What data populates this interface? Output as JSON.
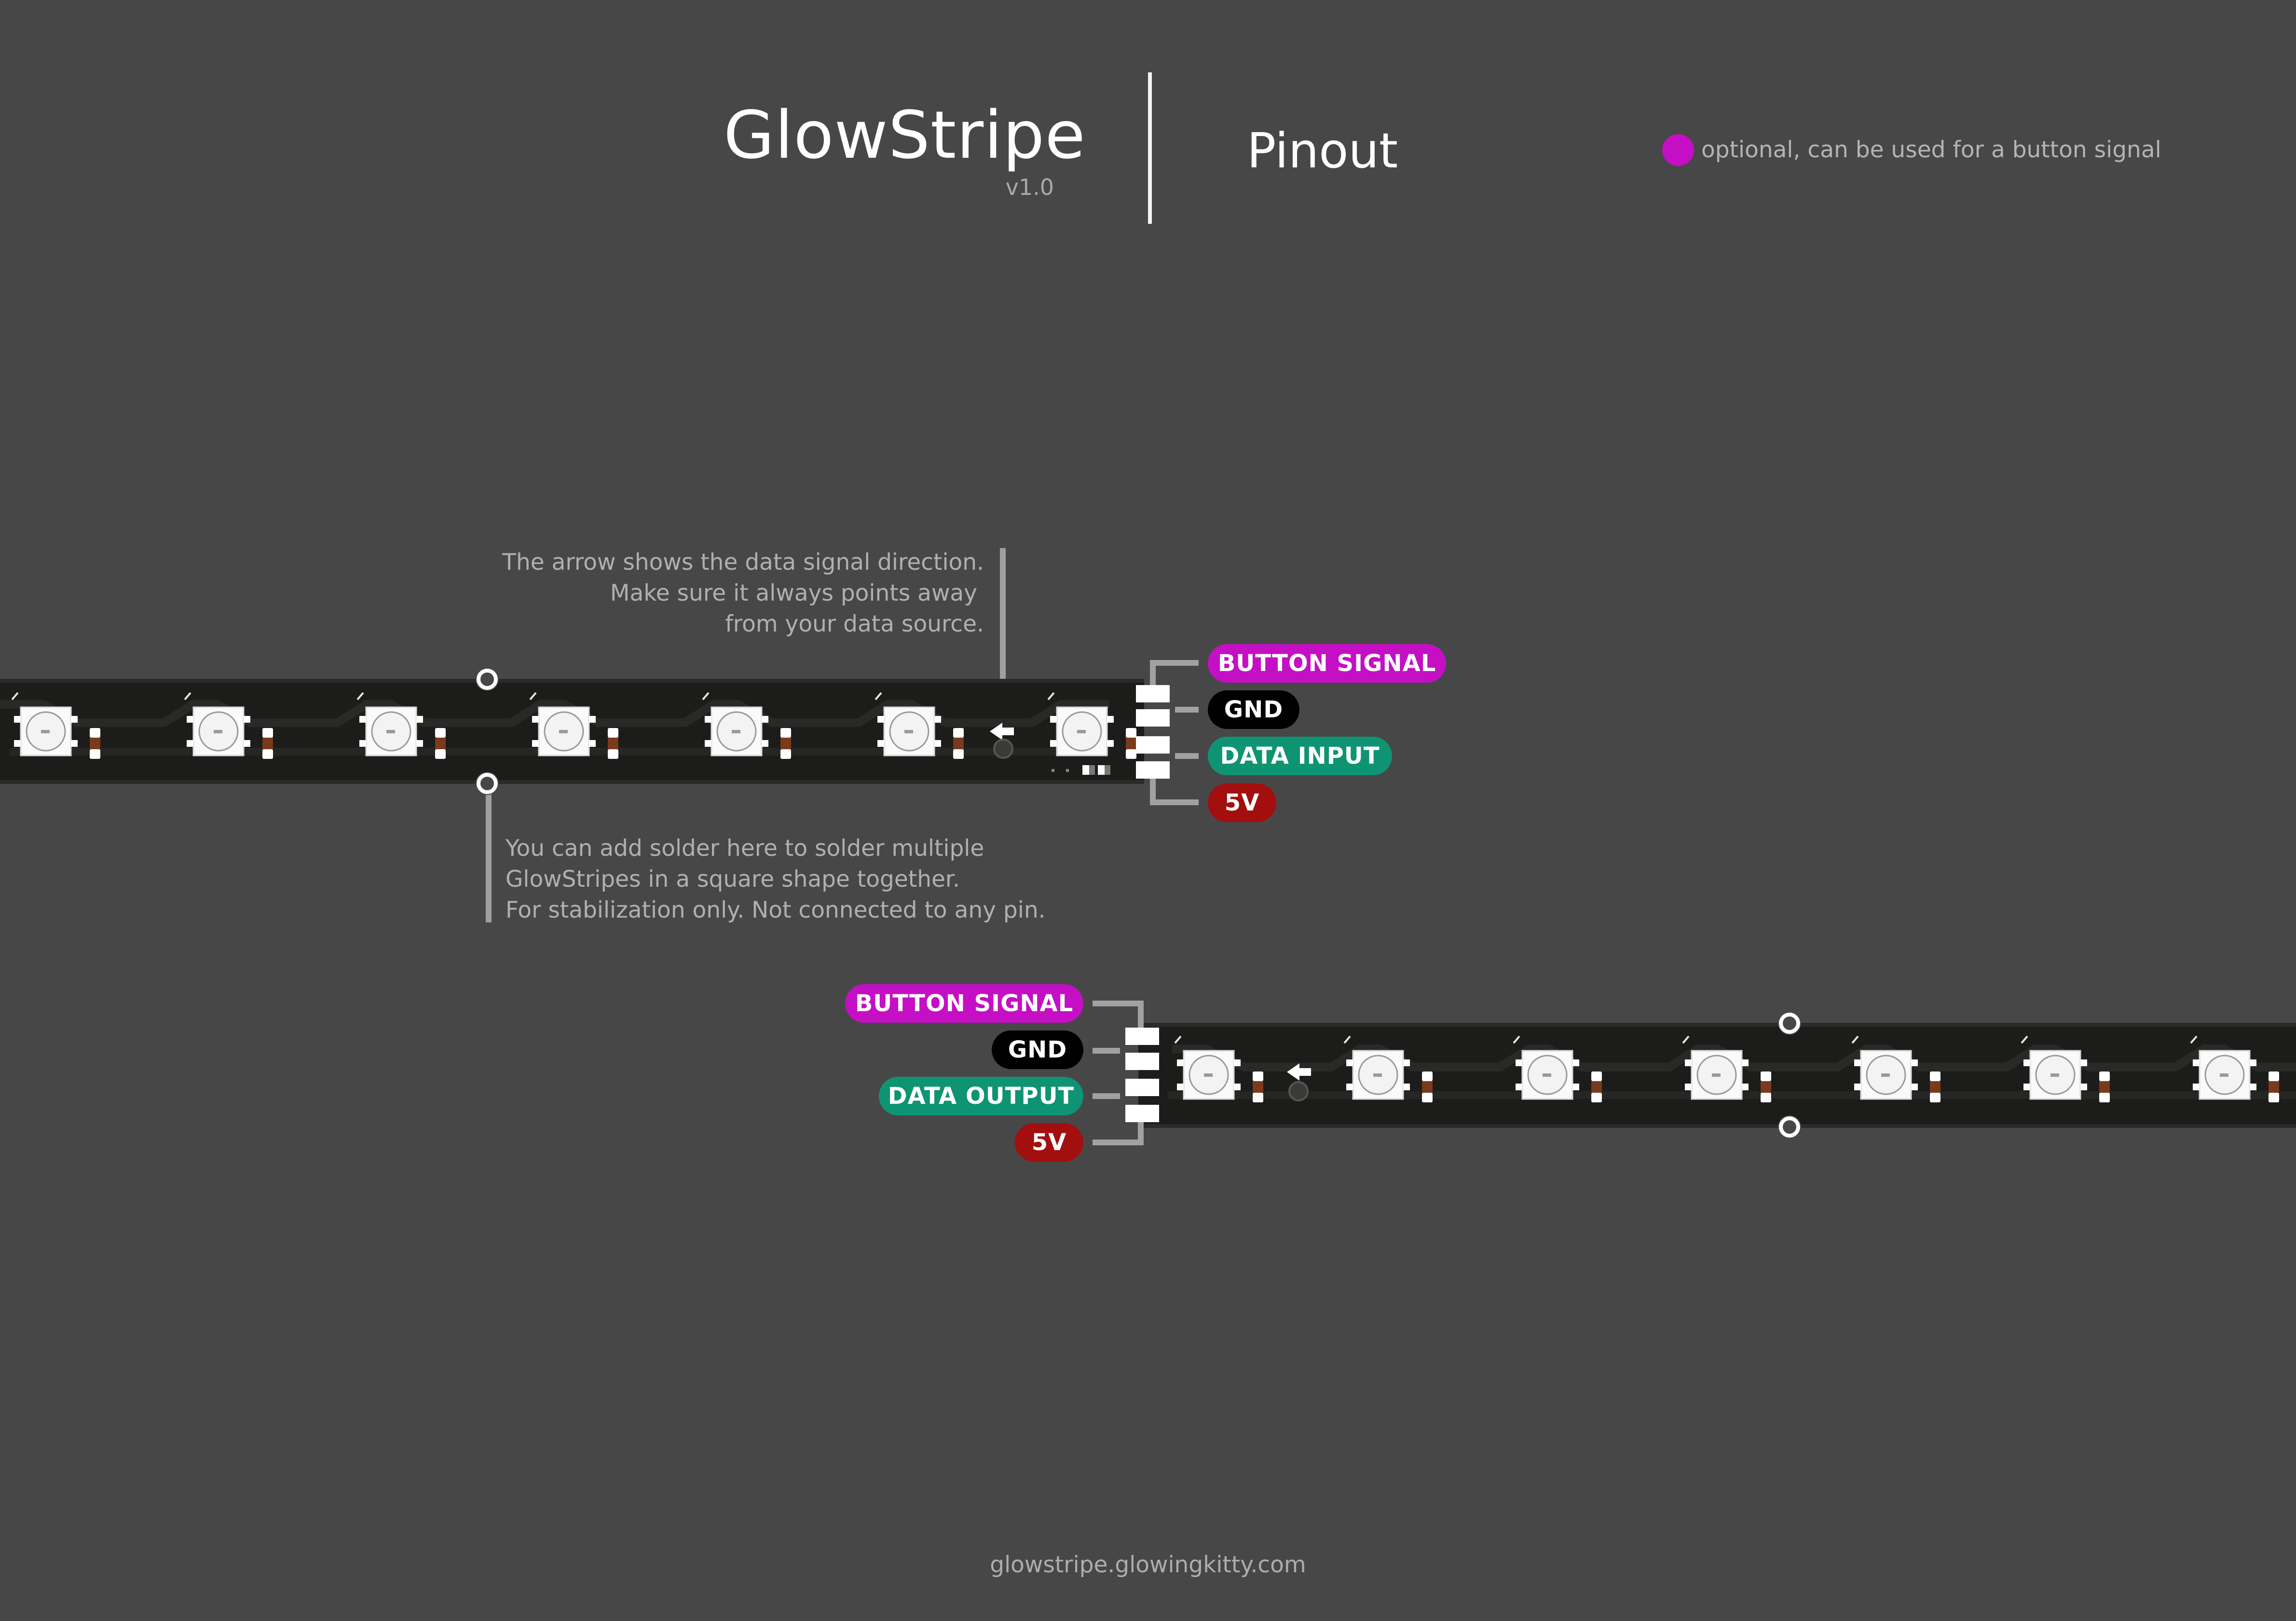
{
  "header": {
    "title": "GlowStripe",
    "version": "v1.0",
    "subtitle": "Pinout",
    "legend": {
      "text": "optional, can be used for a button signal",
      "color": "#c40fc4"
    }
  },
  "notes": {
    "arrow": [
      "The arrow shows the data signal direction.",
      "Make sure it always points away",
      "from your data source."
    ],
    "solder": [
      "You can add solder here to solder multiple",
      "GlowStripes in a square shape together.",
      "For stabilization only. Not connected to any pin."
    ]
  },
  "strip_top": {
    "pins": [
      {
        "label": "BUTTON SIGNAL",
        "kind": "button"
      },
      {
        "label": "GND",
        "kind": "gnd"
      },
      {
        "label": "DATA INPUT",
        "kind": "data"
      },
      {
        "label": "5V",
        "kind": "v5"
      }
    ]
  },
  "strip_bottom": {
    "pins": [
      {
        "label": "BUTTON SIGNAL",
        "kind": "button"
      },
      {
        "label": "GND",
        "kind": "gnd"
      },
      {
        "label": "DATA OUTPUT",
        "kind": "data"
      },
      {
        "label": "5V",
        "kind": "v5"
      }
    ]
  },
  "colors": {
    "background": "#474747",
    "pcb": "#1c1c1a",
    "button_signal": "#c40fc4",
    "gnd": "#000000",
    "data": "#0f9473",
    "v5": "#a30e0e"
  },
  "footer": {
    "url": "glowstripe.glowingkitty.com"
  }
}
